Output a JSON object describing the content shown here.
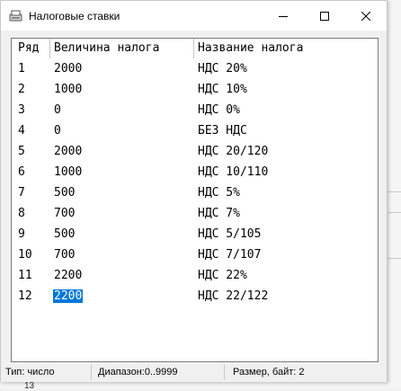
{
  "window": {
    "title": "Налоговые ставки"
  },
  "table": {
    "columns": [
      "Ряд",
      "Величина налога",
      "Название налога"
    ],
    "rows": [
      [
        "1",
        "2000",
        "НДС 20%"
      ],
      [
        "2",
        "1000",
        "НДС 10%"
      ],
      [
        "3",
        "0",
        "НДС 0%"
      ],
      [
        "4",
        "0",
        "БЕЗ НДС"
      ],
      [
        "5",
        "2000",
        "НДС 20/120"
      ],
      [
        "6",
        "1000",
        "НДС 10/110"
      ],
      [
        "7",
        "500",
        "НДС 5%"
      ],
      [
        "8",
        "700",
        "НДС 7%"
      ],
      [
        "9",
        "500",
        "НДС 5/105"
      ],
      [
        "10",
        "700",
        "НДС 7/107"
      ],
      [
        "11",
        "2200",
        "НДС 22%"
      ],
      [
        "12",
        "2200",
        "НДС 22/122"
      ]
    ],
    "selected": {
      "row": 12,
      "column": "Величина налога"
    }
  },
  "status": {
    "type": "Тип: число",
    "range": "Диапазон:0..9999",
    "size": "Размер, байт: 2"
  },
  "background": {
    "partial_number": "13"
  },
  "colors": {
    "selection": "#0078d7",
    "titlebar": "#ffffff",
    "window": "#f0f0f0"
  },
  "icons": [
    "app-icon",
    "minimize-icon",
    "maximize-icon",
    "close-icon"
  ]
}
